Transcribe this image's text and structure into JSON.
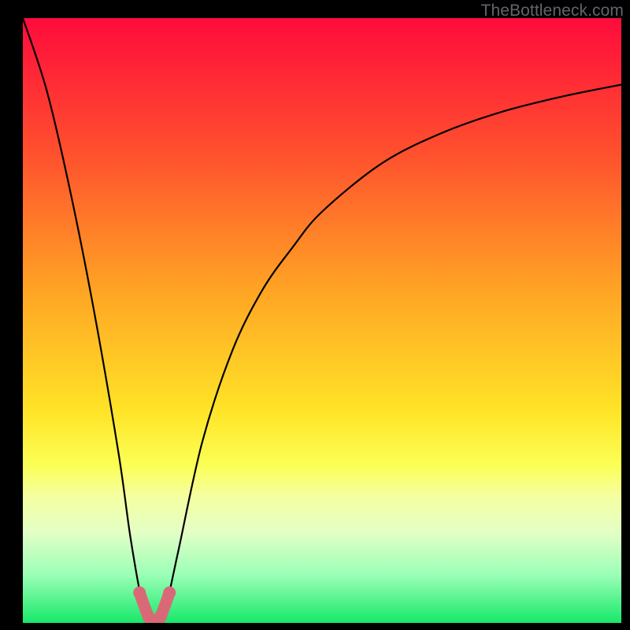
{
  "watermark": "TheBottleneck.com",
  "chart_data": {
    "type": "line",
    "title": "",
    "xlabel": "",
    "ylabel": "",
    "xlim": [
      0,
      100
    ],
    "ylim": [
      0,
      100
    ],
    "series": [
      {
        "name": "bottleneck-curve",
        "x": [
          0,
          4,
          8,
          12,
          16,
          18,
          20,
          21,
          22,
          23,
          24,
          26,
          30,
          35,
          40,
          45,
          50,
          60,
          70,
          80,
          90,
          100
        ],
        "values": [
          100,
          88,
          71,
          51,
          28,
          14,
          3,
          1,
          0,
          1,
          3,
          12,
          30,
          45,
          55,
          62,
          68,
          76,
          81,
          84.5,
          87,
          89
        ]
      }
    ],
    "highlight": {
      "name": "optimal-range",
      "x": [
        19.5,
        21,
        22,
        23,
        24.5
      ],
      "values": [
        5,
        1,
        0,
        1,
        5
      ]
    },
    "gradient_stops": [
      {
        "pct": 0,
        "color": "#ff0b3c"
      },
      {
        "pct": 22,
        "color": "#ff4f2e"
      },
      {
        "pct": 45,
        "color": "#ffa424"
      },
      {
        "pct": 65,
        "color": "#ffe427"
      },
      {
        "pct": 74,
        "color": "#fbff56"
      },
      {
        "pct": 79,
        "color": "#f5ffa0"
      },
      {
        "pct": 85,
        "color": "#e3ffc6"
      },
      {
        "pct": 92,
        "color": "#9cffb7"
      },
      {
        "pct": 100,
        "color": "#17e86a"
      }
    ]
  }
}
